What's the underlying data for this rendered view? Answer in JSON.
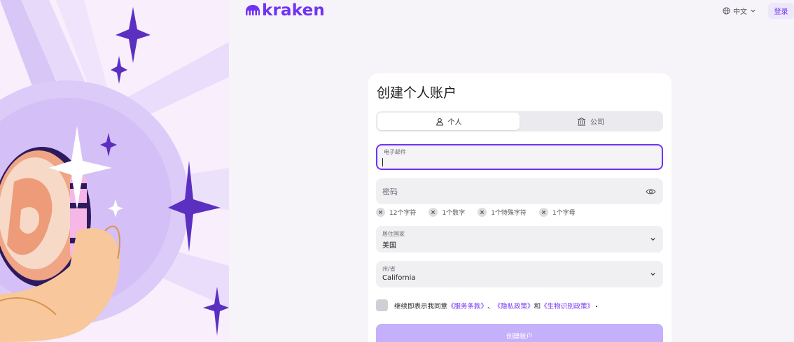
{
  "brand": {
    "name": "kraken",
    "color": "#7132f5"
  },
  "header": {
    "language": "中文",
    "login_label": "登录"
  },
  "form": {
    "title": "创建个人账户",
    "tabs": [
      {
        "label": "个人",
        "icon": "user-icon",
        "active": true
      },
      {
        "label": "公司",
        "icon": "bank-icon",
        "active": false
      }
    ],
    "email": {
      "label": "电子邮件",
      "value": ""
    },
    "password": {
      "placeholder": "密码",
      "icon": "eye-icon"
    },
    "password_requirements": [
      "12个字符",
      "1个数字",
      "1个特殊字符",
      "1个字母"
    ],
    "country": {
      "label": "居住国家",
      "value": "美国"
    },
    "state": {
      "label": "州/省",
      "value": "California"
    },
    "agreement": {
      "prefix": "继续即表示我同意",
      "terms": "《服务条款》",
      "sep": "、",
      "privacy": "《隐私政策》",
      "and": "和",
      "biometric": "《生物识别政策》",
      "end": "."
    },
    "submit_label": "创建帐户"
  }
}
